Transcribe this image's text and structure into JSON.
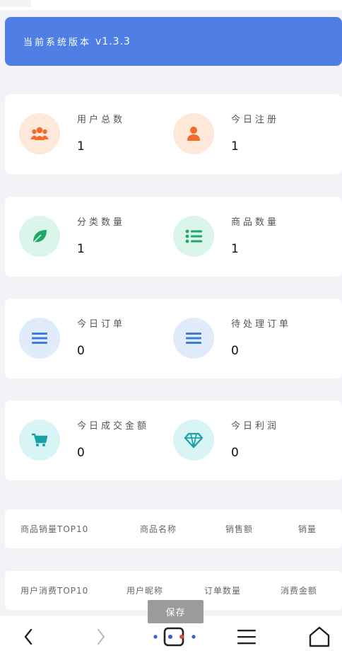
{
  "version": {
    "label": "当前系统版本",
    "number": "v1.3.3"
  },
  "stats": [
    {
      "title": "用户总数",
      "value": "1",
      "icon": "users-icon"
    },
    {
      "title": "今日注册",
      "value": "1",
      "icon": "user-icon"
    },
    {
      "title": "分类数量",
      "value": "1",
      "icon": "leaf-icon"
    },
    {
      "title": "商品数量",
      "value": "1",
      "icon": "list-icon"
    },
    {
      "title": "今日订单",
      "value": "0",
      "icon": "menu-icon"
    },
    {
      "title": "待处理订单",
      "value": "0",
      "icon": "menu-icon"
    },
    {
      "title": "今日成交金额",
      "value": "0",
      "icon": "cart-icon"
    },
    {
      "title": "今日利润",
      "value": "0",
      "icon": "diamond-icon"
    }
  ],
  "product_table": {
    "headers": [
      "商品销量TOP10",
      "商品名称",
      "销售额",
      "销量"
    ]
  },
  "user_table": {
    "headers": [
      "用户消费TOP10",
      "用户昵称",
      "订单数量",
      "消费金额"
    ]
  },
  "save_tip": "保存",
  "colors": {
    "banner": "#4f7fe4",
    "orange": "#f26b2a",
    "green": "#1ea866",
    "blue": "#3d7bdb",
    "teal": "#17a2a6"
  }
}
